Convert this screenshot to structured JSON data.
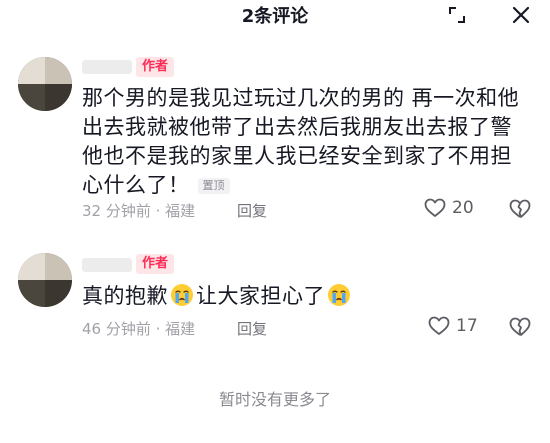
{
  "header": {
    "title": "2条评论",
    "expand_icon": "corner-expand-icon",
    "close_icon": "close-icon"
  },
  "comments": [
    {
      "author_badge": "作者",
      "text": "那个男的是我见过玩过几次的男的 再一次和他出去我就被他带了出去然后我朋友出去报了警他也不是我的家里人我已经安全到家了不用担心什么了！",
      "pin_label": "置顶",
      "time": "32 分钟前",
      "location": "福建",
      "reply_label": "回复",
      "likes": "20"
    },
    {
      "author_badge": "作者",
      "text_parts": [
        "真的抱歉",
        "让大家担心了"
      ],
      "emoji": "crying-face-icon",
      "time": "46 分钟前",
      "location": "福建",
      "reply_label": "回复",
      "likes": "17"
    }
  ],
  "footer": {
    "text": "暂时没有更多了"
  },
  "colors": {
    "accent": "#fe2c55",
    "badge_bg": "#fde5e8",
    "meta": "#a1a2a8"
  }
}
